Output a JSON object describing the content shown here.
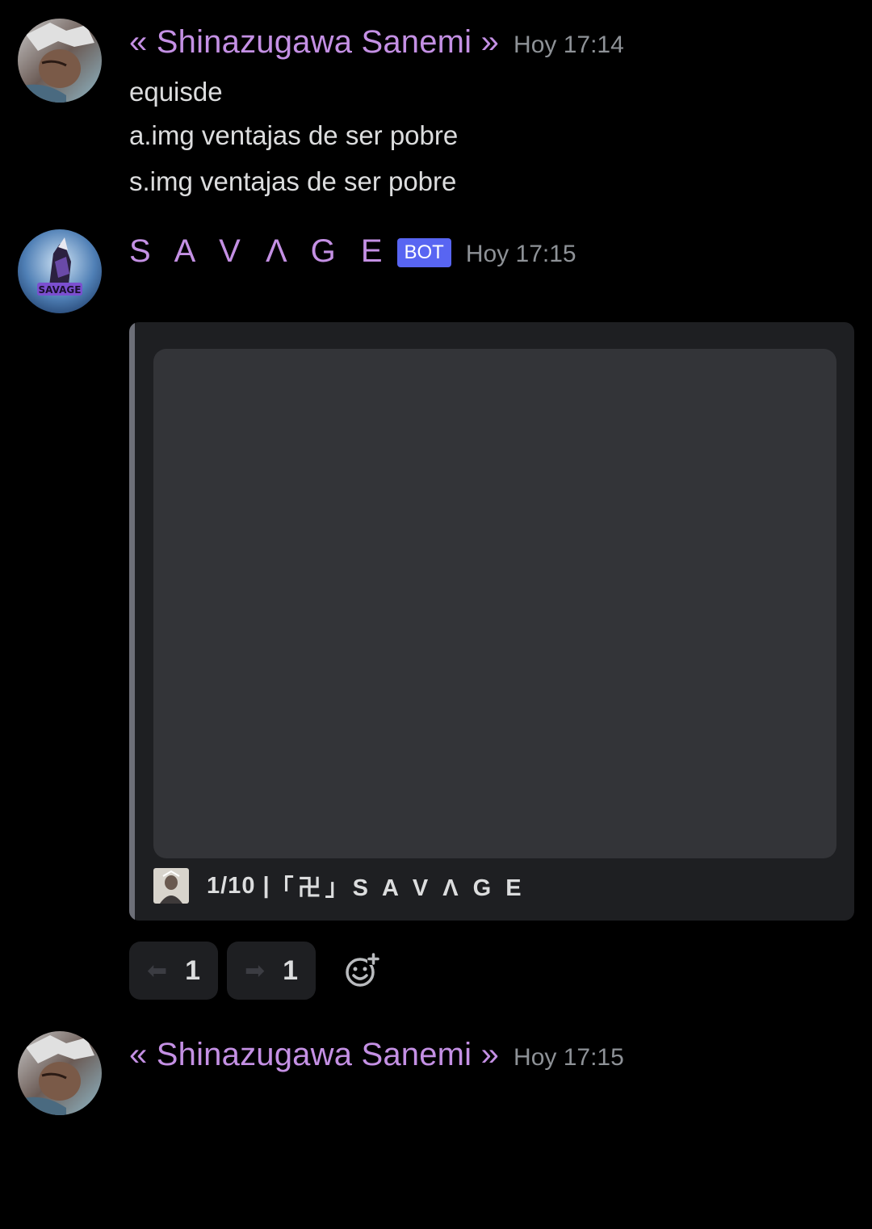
{
  "messages": [
    {
      "author": "« Shinazugawa Sanemi   »",
      "timestamp": "Hoy 17:14",
      "lines": [
        "equisde",
        "a.img ventajas de ser pobre",
        "s.img ventajas de ser pobre"
      ]
    },
    {
      "author": "S A V Λ G E",
      "bot_tag": "BOT",
      "timestamp": "Hoy 17:15",
      "embed": {
        "footer_counter": "1/10 | ",
        "footer_brand": "「卍」S A V Λ G E"
      },
      "reactions": [
        {
          "emoji": "⬅",
          "count": "1"
        },
        {
          "emoji": "➡",
          "count": "1"
        }
      ]
    },
    {
      "author": "« Shinazugawa Sanemi   »",
      "timestamp": "Hoy 17:15"
    }
  ],
  "colors": {
    "background": "#000000",
    "username": "#c490e4",
    "timestamp": "#8e9297",
    "bot_tag": "#5865f2",
    "embed_bg": "#1e1f22",
    "embed_image": "#333438"
  },
  "icons": {
    "add_reaction": "add-reaction-icon"
  }
}
